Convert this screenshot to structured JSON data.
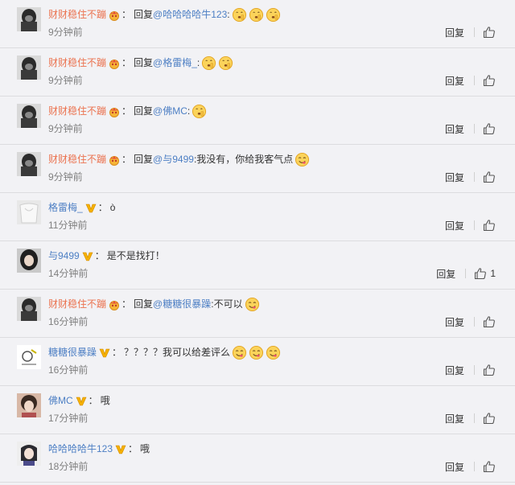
{
  "comments": [
    {
      "user": "财财稳住不蹦",
      "user_color": "#eb7350",
      "badge": "crown-emoji",
      "reply_label": "回复",
      "mention": "@哈哈哈哈牛123",
      "text": ":",
      "emojis": [
        "shush-emoji",
        "shush-emoji",
        "shush-emoji"
      ],
      "time": "9分钟前",
      "reply": "回复",
      "likes": ""
    },
    {
      "user": "财财稳住不蹦",
      "user_color": "#eb7350",
      "badge": "crown-emoji",
      "reply_label": "回复",
      "mention": "@格雷梅_",
      "text": ":",
      "emojis": [
        "shush-emoji",
        "shush-emoji"
      ],
      "time": "9分钟前",
      "reply": "回复",
      "likes": ""
    },
    {
      "user": "财财稳住不蹦",
      "user_color": "#eb7350",
      "badge": "crown-emoji",
      "reply_label": "回复",
      "mention": "@佛MC",
      "text": ":",
      "emojis": [
        "shush-emoji"
      ],
      "time": "9分钟前",
      "reply": "回复",
      "likes": ""
    },
    {
      "user": "财财稳住不蹦",
      "user_color": "#eb7350",
      "badge": "crown-emoji",
      "reply_label": "回复",
      "mention": "@与9499",
      "text": ":我没有，你给我客气点",
      "emojis": [
        "yum-emoji"
      ],
      "time": "9分钟前",
      "reply": "回复",
      "likes": ""
    },
    {
      "user": "格雷梅_",
      "user_color": "#4d7fc4",
      "badge": "v-badge",
      "reply_label": "",
      "mention": "",
      "text": "ò",
      "emojis": [],
      "time": "11分钟前",
      "reply": "回复",
      "likes": ""
    },
    {
      "user": "与9499",
      "user_color": "#4d7fc4",
      "badge": "v-badge",
      "reply_label": "",
      "mention": "",
      "text": "是不是找打！",
      "emojis": [],
      "time": "14分钟前",
      "reply": "回复",
      "likes": "1"
    },
    {
      "user": "财财稳住不蹦",
      "user_color": "#eb7350",
      "badge": "crown-emoji",
      "reply_label": "回复",
      "mention": "@糖糖很暴躁",
      "text": ":不可以",
      "emojis": [
        "yum-emoji"
      ],
      "time": "16分钟前",
      "reply": "回复",
      "likes": ""
    },
    {
      "user": "糖糖很暴躁",
      "user_color": "#4d7fc4",
      "badge": "v-badge",
      "reply_label": "",
      "mention": "",
      "text": "？？？？我可以给差评么",
      "emojis": [
        "yum-emoji",
        "yum-emoji",
        "yum-emoji"
      ],
      "time": "16分钟前",
      "reply": "回复",
      "likes": ""
    },
    {
      "user": "佛MC",
      "user_color": "#4d7fc4",
      "badge": "v-badge",
      "reply_label": "",
      "mention": "",
      "text": "哦",
      "emojis": [],
      "time": "17分钟前",
      "reply": "回复",
      "likes": ""
    },
    {
      "user": "哈哈哈哈牛123",
      "user_color": "#4d7fc4",
      "badge": "v-badge",
      "reply_label": "",
      "mention": "",
      "text": "哦",
      "emojis": [],
      "time": "18分钟前",
      "reply": "回复",
      "likes": ""
    }
  ],
  "avatar_styles": [
    "dark-hood",
    "dark-hood",
    "dark-hood",
    "dark-hood",
    "white-cloth",
    "girl-dark-hair",
    "dark-hood",
    "cartoon",
    "girl-face",
    "girl-bob"
  ]
}
